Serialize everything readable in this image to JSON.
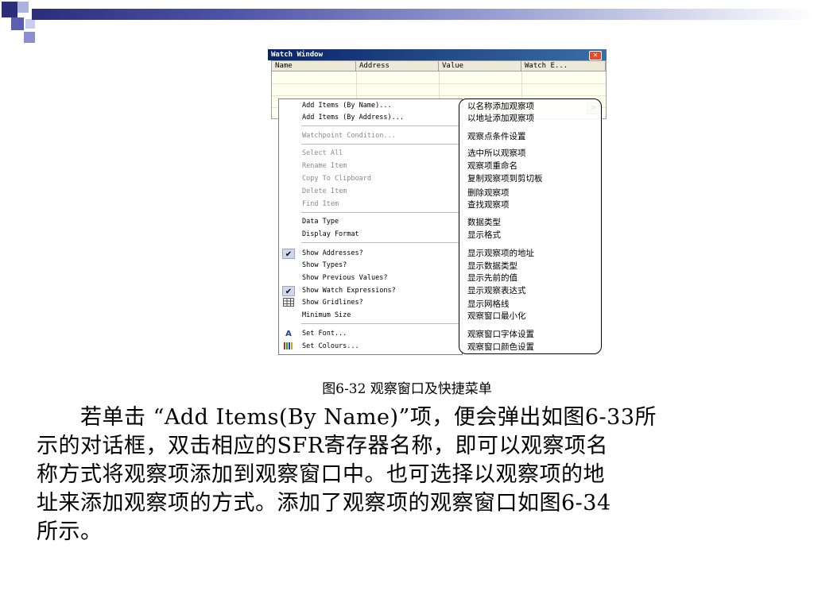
{
  "colors": {
    "header_dark": "#2b2f7a",
    "header_mid": "#5a5fb0",
    "header_light": "#aeb2de",
    "titlebar": "#0a246a"
  },
  "window": {
    "title": "Watch Window",
    "columns": [
      "Name",
      "Address",
      "Value",
      "Watch E..."
    ],
    "close_icon": "close-x-icon",
    "scroll_icon": "scroll-right-arrow-icon"
  },
  "menu": {
    "items": [
      {
        "label": "Add Items (By Name)...",
        "enabled": true
      },
      {
        "label": "Add Items (By Address)...",
        "enabled": true
      },
      {
        "label": "Watchpoint Condition...",
        "enabled": false
      },
      {
        "label": "Select All",
        "enabled": false
      },
      {
        "label": "Rename Item",
        "enabled": false
      },
      {
        "label": "Copy To Clipboard",
        "enabled": false
      },
      {
        "label": "Delete Item",
        "enabled": false
      },
      {
        "label": "Find Item",
        "enabled": false
      },
      {
        "label": "Data Type",
        "enabled": true
      },
      {
        "label": "Display Format",
        "enabled": true
      },
      {
        "label": "Show Addresses?",
        "enabled": true,
        "checked": true
      },
      {
        "label": "Show Types?",
        "enabled": true
      },
      {
        "label": "Show Previous Values?",
        "enabled": true
      },
      {
        "label": "Show Watch Expressions?",
        "enabled": true,
        "checked": true
      },
      {
        "label": "Show Gridlines?",
        "enabled": true,
        "icon": "grid-icon"
      },
      {
        "label": "Minimum Size",
        "enabled": true
      },
      {
        "label": "Set Font...",
        "enabled": true,
        "icon": "font-icon"
      },
      {
        "label": "Set Colours...",
        "enabled": true,
        "icon": "colours-icon"
      }
    ],
    "check_icon": "checkmark-icon"
  },
  "callout": {
    "items": [
      "以名称添加观察项",
      "以地址添加观察项",
      "观察点条件设置",
      "选中所以观察项",
      "观察项重命名",
      "复制观察项到剪切板",
      "删除观察项",
      "查找观察项",
      "数据类型",
      "显示格式",
      "显示观察项的地址",
      "显示数据类型",
      "显示先前的值",
      "显示观察表达式",
      "显示网格线",
      "观察窗口最小化",
      "观察窗口字体设置",
      "观察窗口颜色设置"
    ]
  },
  "caption": "图6-32  观察窗口及快捷菜单",
  "paragraph": {
    "lines": [
      "　　若单击 “Add Items(By Name)”项，便会弹出如图6-33所",
      "示的对话框，双击相应的SFR寄存器名称，即可以观察项名",
      "称方式将观察项添加到观察窗口中。也可选择以观察项的地",
      "址来添加观察项的方式。添加了观察项的观察窗口如图6-34",
      "所示。"
    ]
  }
}
